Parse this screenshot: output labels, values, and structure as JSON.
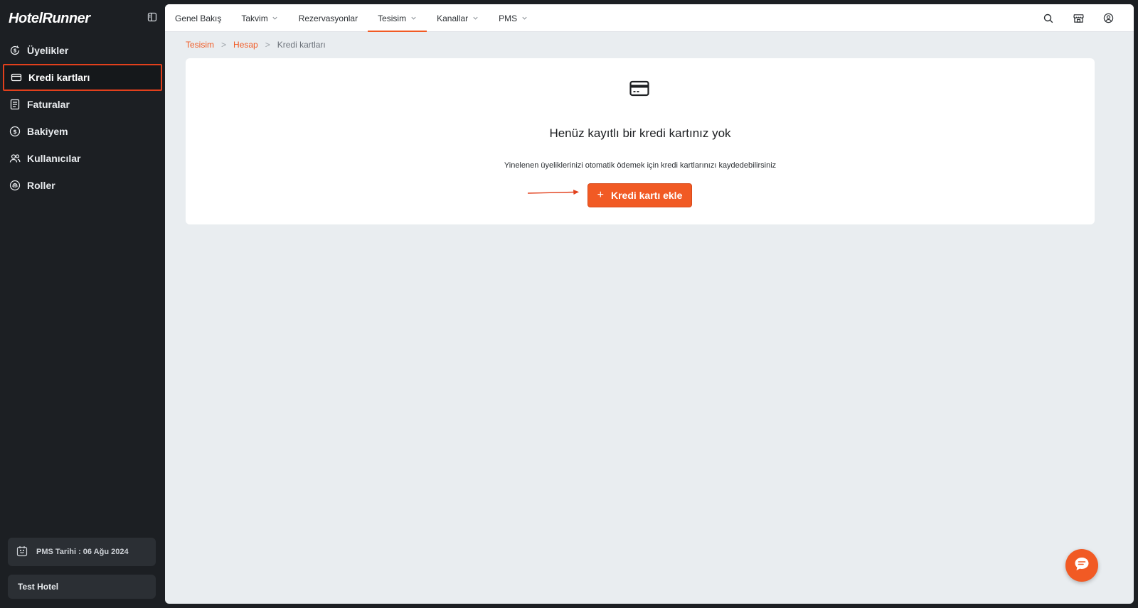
{
  "sidebar": {
    "brand": "HotelRunner",
    "items": [
      {
        "label": "Üyelikler",
        "icon": "dollar-refresh-icon",
        "active": false
      },
      {
        "label": "Kredi kartları",
        "icon": "credit-card-icon",
        "active": true
      },
      {
        "label": "Faturalar",
        "icon": "invoice-icon",
        "active": false
      },
      {
        "label": "Bakiyem",
        "icon": "dollar-circle-icon",
        "active": false
      },
      {
        "label": "Kullanıcılar",
        "icon": "users-icon",
        "active": false
      },
      {
        "label": "Roller",
        "icon": "fingerprint-icon",
        "active": false
      }
    ],
    "pms_date": "PMS Tarihi : 06 Ağu 2024",
    "hotel_name": "Test Hotel"
  },
  "topbar": {
    "tabs": [
      {
        "label": "Genel Bakış",
        "dropdown": false
      },
      {
        "label": "Takvim",
        "dropdown": true
      },
      {
        "label": "Rezervasyonlar",
        "dropdown": false
      },
      {
        "label": "Tesisim",
        "dropdown": true,
        "active": true
      },
      {
        "label": "Kanallar",
        "dropdown": true
      },
      {
        "label": "PMS",
        "dropdown": true
      }
    ]
  },
  "breadcrumb": {
    "items": [
      "Tesisim",
      "Hesap",
      "Kredi kartları"
    ],
    "separator": ">"
  },
  "empty_state": {
    "title": "Henüz kayıtlı bir kredi kartınız yok",
    "description": "Yinelenen üyeliklerinizi otomatik ödemek için kredi kartlarınızı kaydedebilirsiniz",
    "button_icon": "+",
    "button_label": "Kredi kartı ekle"
  },
  "colors": {
    "accent": "#f15a24",
    "sidebar_bg": "#1c1f23",
    "content_bg": "#e9edf0",
    "highlight_border": "#e2401c"
  }
}
